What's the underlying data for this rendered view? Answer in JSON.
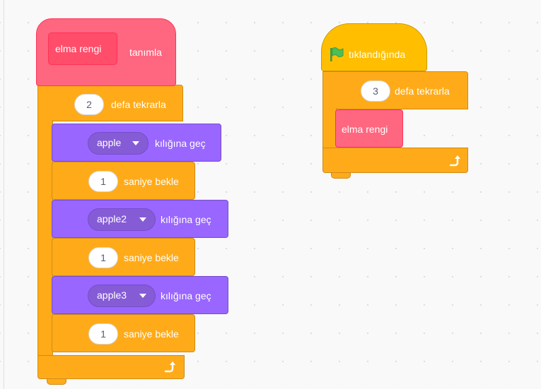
{
  "define_script": {
    "name": "elma rengi",
    "keyword": "tanımla",
    "repeat": {
      "count": "2",
      "label": "defa tekrarla"
    },
    "steps": [
      {
        "costume": "apple",
        "switch_label": "kılığına geç",
        "wait": "1",
        "wait_label": "saniye bekle"
      },
      {
        "costume": "apple2",
        "switch_label": "kılığına geç",
        "wait": "1",
        "wait_label": "saniye bekle"
      },
      {
        "costume": "apple3",
        "switch_label": "kılığına geç",
        "wait": "1",
        "wait_label": "saniye bekle"
      }
    ]
  },
  "flag_script": {
    "hat_label": "tıklandığında",
    "repeat": {
      "count": "3",
      "label": "defa tekrarla"
    },
    "call": "elma rengi"
  },
  "colors": {
    "control": "#ffab19",
    "my_blocks": "#ff6680",
    "looks": "#9966ff",
    "flag": "#4cbf56"
  },
  "icons": [
    "green-flag-icon",
    "loop-arrow-icon",
    "dropdown-caret-icon"
  ]
}
